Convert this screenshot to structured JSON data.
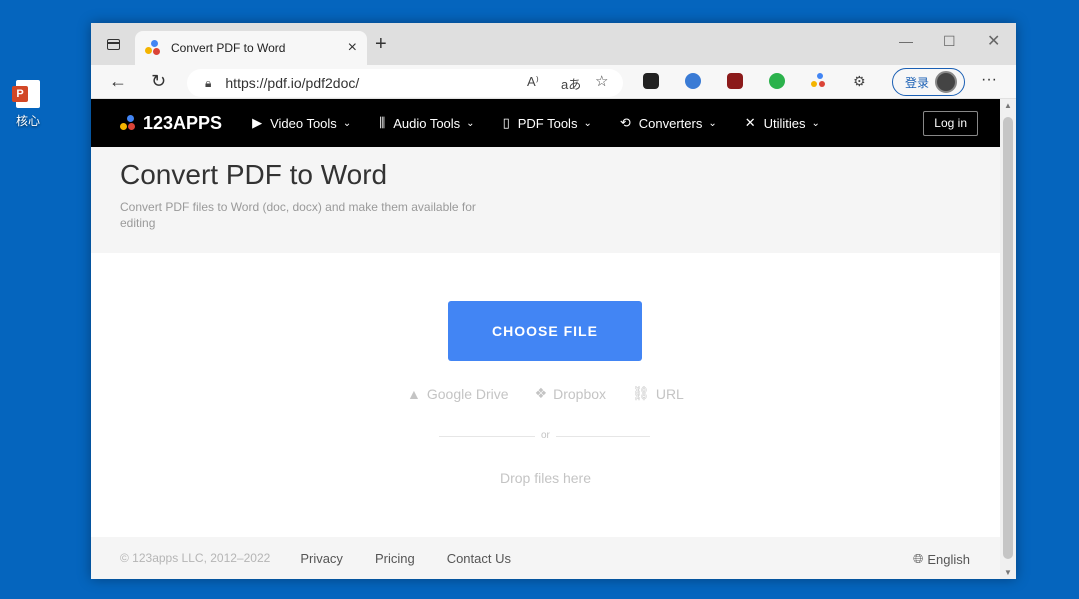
{
  "desktop": {
    "icon_label": "核心",
    "icon_name": "powerpoint-file-icon"
  },
  "browser": {
    "tab_title": "Convert PDF to Word",
    "url": "https://pdf.io/pdf2doc/",
    "profile_label": "登录",
    "read_aloud_glyph": "A⁾",
    "translate_glyph": "aあ"
  },
  "site": {
    "logo_text": "123APPS",
    "nav": [
      {
        "label": "Video Tools",
        "icon": "video-icon"
      },
      {
        "label": "Audio Tools",
        "icon": "audio-icon"
      },
      {
        "label": "PDF Tools",
        "icon": "pdf-icon"
      },
      {
        "label": "Converters",
        "icon": "converters-icon"
      },
      {
        "label": "Utilities",
        "icon": "utilities-icon"
      }
    ],
    "login_label": "Log in"
  },
  "hero": {
    "title": "Convert PDF to Word",
    "subtitle": "Convert PDF files to Word (doc, docx) and make them available for editing"
  },
  "upload": {
    "choose_label": "CHOOSE FILE",
    "sources": [
      "Google Drive",
      "Dropbox",
      "URL"
    ],
    "or_label": "or",
    "drop_label": "Drop files here"
  },
  "footer": {
    "copyright": "© 123apps LLC, 2012–2022",
    "links": [
      "Privacy",
      "Pricing",
      "Contact Us"
    ],
    "language": "English"
  },
  "colors": {
    "primary_button": "#4285f4",
    "nav_bg": "#000000",
    "desktop_bg": "#0565be"
  }
}
